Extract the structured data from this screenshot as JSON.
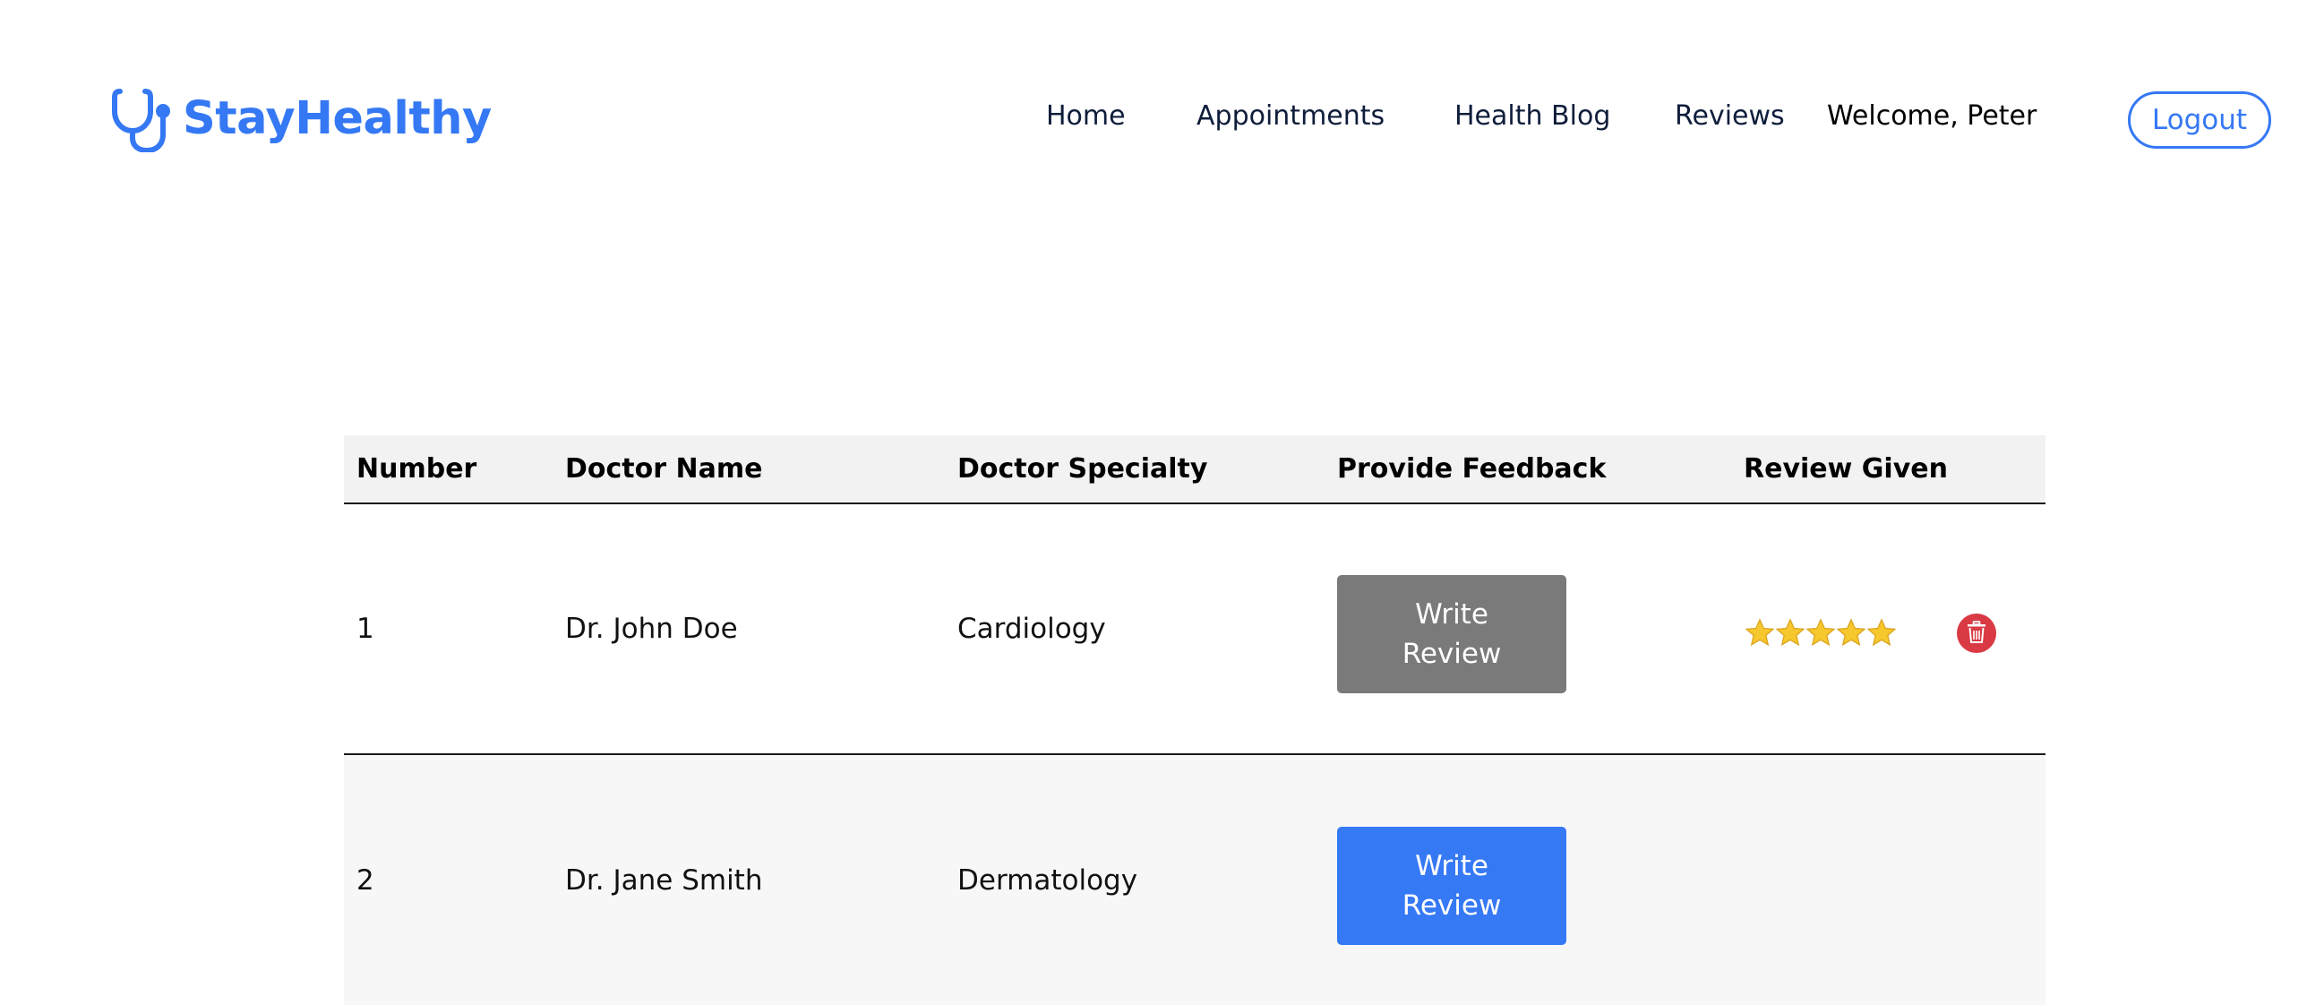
{
  "navbar": {
    "brand": "StayHealthy",
    "brand_color": "#3578f4",
    "links": {
      "home": "Home",
      "appointments": "Appointments",
      "health_blog": "Health Blog",
      "reviews": "Reviews"
    },
    "welcome": "Welcome, Peter",
    "logout": "Logout"
  },
  "table": {
    "headers": {
      "number": "Number",
      "doctor_name": "Doctor Name",
      "doctor_specialty": "Doctor Specialty",
      "provide_feedback": "Provide Feedback",
      "review_given": "Review Given"
    },
    "rows": [
      {
        "number": "1",
        "doctor_name": "Dr. John Doe",
        "doctor_specialty": "Cardiology",
        "button_line1": "Write",
        "button_line2": "Review",
        "button_state": "disabled",
        "rating": 5,
        "rating_icon": "star-icon",
        "delete_icon": "trash-icon"
      },
      {
        "number": "2",
        "doctor_name": "Dr. Jane Smith",
        "doctor_specialty": "Dermatology",
        "button_line1": "Write",
        "button_line2": "Review",
        "button_state": "enabled"
      }
    ]
  },
  "colors": {
    "primary": "#3578f4",
    "disabled_button": "#7a7a7a",
    "delete": "#d93a44",
    "star": "#f7c72e"
  }
}
